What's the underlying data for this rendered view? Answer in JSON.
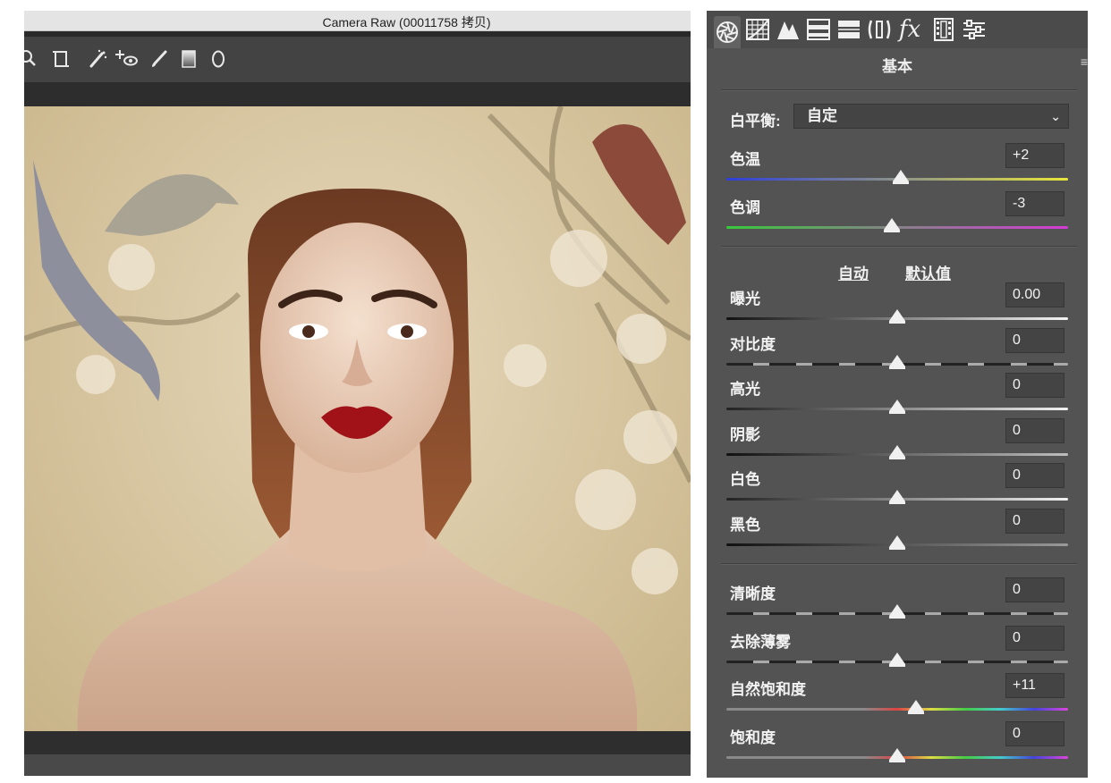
{
  "window": {
    "title": "Camera Raw (00011758 拷贝)"
  },
  "toolbar": {
    "tools": [
      "zoom-icon",
      "transform-icon",
      "spot-removal-icon",
      "red-eye-icon",
      "adjustment-brush-icon",
      "graduated-filter-icon",
      "radial-filter-icon"
    ]
  },
  "panel": {
    "tabs": [
      "basic-tab-icon",
      "tone-curve-tab-icon",
      "detail-tab-icon",
      "hsl-tab-icon",
      "split-toning-tab-icon",
      "lens-corrections-tab-icon",
      "effects-tab-icon",
      "camera-calibration-tab-icon",
      "presets-tab-icon"
    ],
    "effects_tab_glyph": "fx",
    "title": "基本",
    "menu_glyph": "≡",
    "white_balance": {
      "label": "白平衡:",
      "value": "自定",
      "chevron": "⌄"
    },
    "auto_label": "自动",
    "default_label": "默认值",
    "sliders": [
      {
        "key": "temp",
        "label": "色温",
        "value": "+2",
        "amount": 2,
        "min": -100,
        "max": 100
      },
      {
        "key": "tint",
        "label": "色调",
        "value": "-3",
        "amount": -3,
        "min": -100,
        "max": 100
      },
      {
        "key": "exposure",
        "label": "曝光",
        "value": "0.00",
        "amount": 0,
        "min": -5,
        "max": 5
      },
      {
        "key": "contrast",
        "label": "对比度",
        "value": "0",
        "amount": 0,
        "min": -100,
        "max": 100
      },
      {
        "key": "highlights",
        "label": "高光",
        "value": "0",
        "amount": 0,
        "min": -100,
        "max": 100
      },
      {
        "key": "shadows",
        "label": "阴影",
        "value": "0",
        "amount": 0,
        "min": -100,
        "max": 100
      },
      {
        "key": "whites",
        "label": "白色",
        "value": "0",
        "amount": 0,
        "min": -100,
        "max": 100
      },
      {
        "key": "blacks",
        "label": "黑色",
        "value": "0",
        "amount": 0,
        "min": -100,
        "max": 100
      },
      {
        "key": "clarity",
        "label": "清晰度",
        "value": "0",
        "amount": 0,
        "min": -100,
        "max": 100
      },
      {
        "key": "dehaze",
        "label": "去除薄雾",
        "value": "0",
        "amount": 0,
        "min": -100,
        "max": 100
      },
      {
        "key": "vibrance",
        "label": "自然饱和度",
        "value": "+11",
        "amount": 11,
        "min": -100,
        "max": 100
      },
      {
        "key": "saturation",
        "label": "饱和度",
        "value": "0",
        "amount": 0,
        "min": -100,
        "max": 100
      }
    ]
  },
  "colors": {
    "panel_bg": "#535353",
    "temp_gradient": [
      "#2f3fd9",
      "#e8e63a"
    ],
    "tint_gradient": [
      "#38c93b",
      "#d43ad6"
    ]
  }
}
